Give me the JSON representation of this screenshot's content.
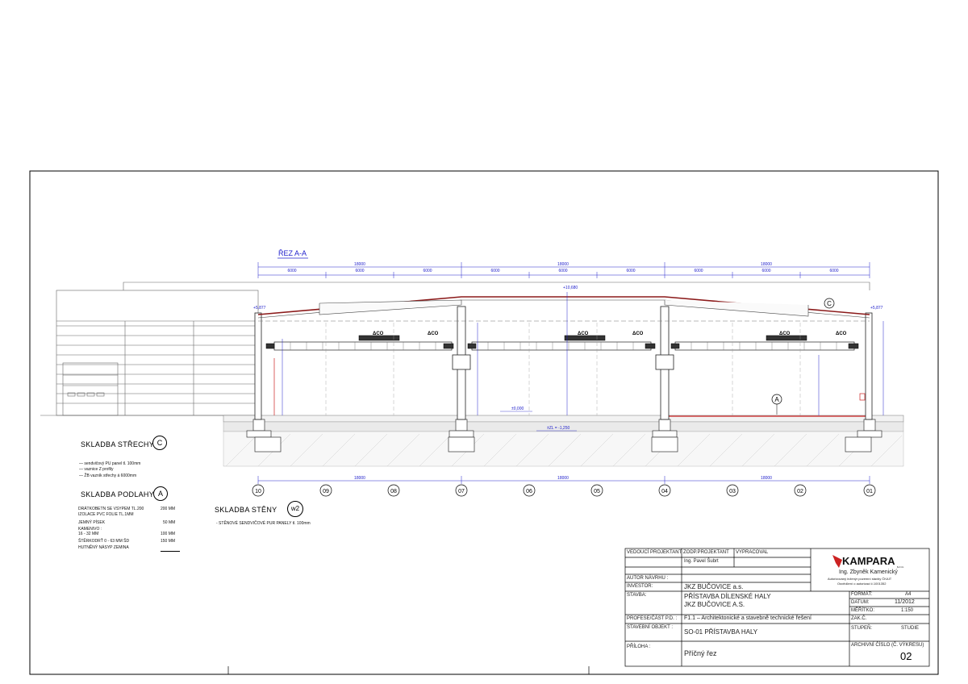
{
  "drawing": {
    "section_title": "ŘEZ A-A",
    "dims_top_total": [
      "18000",
      "18000",
      "18000"
    ],
    "dims_top_parts": [
      "6000",
      "6000",
      "6000",
      "6000",
      "6000",
      "6000",
      "6000",
      "6000",
      "6000"
    ],
    "level_ridge": "+10,680",
    "level_eave_left": "+5,877",
    "level_eave_right": "+5,877",
    "level_floor": "±0,000",
    "level_subgrade": "±ZL = -1,250",
    "axes": [
      "10",
      "09",
      "08",
      "07",
      "06",
      "05",
      "04",
      "03",
      "02",
      "01"
    ],
    "dims_bottom": [
      "18000",
      "18000",
      "18000"
    ],
    "crane_label": "ΔCO",
    "marker_c": "C",
    "marker_a": "A"
  },
  "legend": {
    "roof_heading": "SKLADBA  STŘECHY",
    "roof_marker": "C",
    "roof_items": [
      "—   sendvičový PU panel tl. 100mm",
      "—   vaznice Z profily",
      "—   ŽB vazník střechy á 6000mm"
    ],
    "floor_heading": "SKLADBA  PODLAHY",
    "floor_marker": "A",
    "floor_items": [
      {
        "label": "DRÁTKOBETN SE VSYPEM TL.200",
        "value": "200 MM"
      },
      {
        "label": "IZOLACE PVC FOLIE TL.1MM",
        "value": ""
      },
      {
        "label": "JEMNÝ PÍSEK",
        "value": "50 MM"
      },
      {
        "label": "KAMENIVO :",
        "value": ""
      },
      {
        "label": "16 - 32 MM",
        "value": "100 MM"
      },
      {
        "label": "ŠTĚRKODRŤ 0 - 63 MM    ŠD",
        "value": "150 MM"
      },
      {
        "label": "HUTNĚNÝ NÁSYP ZEMINA",
        "value": ""
      }
    ],
    "wall_heading": "SKLADBA  STĚNY",
    "wall_marker": "w2",
    "wall_items": [
      "- STĚNOVÉ SENDVIČOVÉ PUR  PANELY  tl. 100mm"
    ]
  },
  "title_block": {
    "lead_designer_label": "VEDOUCÍ  PROJEKTANT",
    "responsible_label": "ZODP.PROJEKTANT",
    "responsible_value": "Ing. Pavel Šubrt",
    "prepared_label": "VYPRACOVAL",
    "author_label": "AUTOR NÁVRHU :",
    "investor_label": "INVESTOR:",
    "investor_value": "JKZ  BUČOVICE  a.s.",
    "logo_text": "KAMPARA",
    "logo_sub": "s.r.o.",
    "engineer_name": "Ing. Zbyněk Kamenický",
    "engineer_line1": "Autorizovaný inženýr pozemní stavby ČKAIT",
    "engineer_line2": "Osvědčení o autorizaci č.1001352",
    "building_label": "STAVBA:",
    "building_value1": "PŘÍSTAVBA DÍLENSKÉ HALY",
    "building_value2": "JKZ BUČOVICE A.S.",
    "format_label": "FORMÁT:",
    "format_value": "A4",
    "date_label": "DATUM:",
    "date_value": "11/2012",
    "scale_label": "MĚŘÍTKO:",
    "scale_value": "1:150",
    "profession_label": "PROFESE/ČÁST P.D. :",
    "profession_value": "F1.1  –  Architektonické  a  stavebně  technické  řešení",
    "job_label": "ZAK.Č.",
    "object_label": "STAVEBNÍ  OBJEKT  :",
    "object_value": "SO-01 PŘÍSTAVBA  HALY",
    "stage_label": "STUPEŇ:",
    "stage_value": "STUDIE",
    "attachment_label": "PŘÍLOHA  :",
    "attachment_value": "Příčný řez",
    "drawing_no_label": "ARCHIVNÍ  ČÍSLO  (Č. VÝKRESU)",
    "drawing_no_value": "02"
  },
  "colors": {
    "dimension_blue": "#2222cc",
    "roof_red": "#8b1a1a",
    "grid_gray": "#888888"
  }
}
